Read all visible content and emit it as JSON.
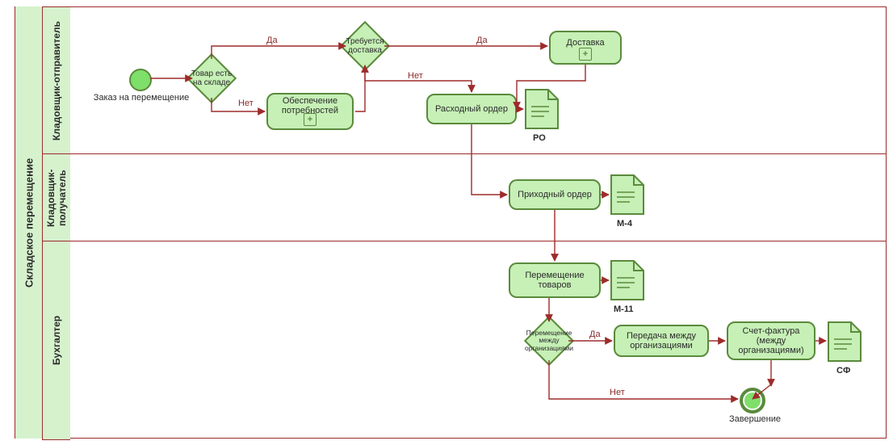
{
  "pool": {
    "title": "Складское перемещение"
  },
  "lanes": {
    "sender": {
      "title": "Кладовщик-отправитель"
    },
    "receiver": {
      "title": "Кладовщик-получатель"
    },
    "accountant": {
      "title": "Бухгалтер"
    }
  },
  "events": {
    "start": {
      "label": "Заказ на перемещение"
    },
    "end": {
      "label": "Завершение"
    }
  },
  "gateways": {
    "stock": {
      "label": "Товар есть на складе"
    },
    "delivery": {
      "label": "Требуется доставка"
    },
    "interorg": {
      "label": "Перемещение между организациями"
    }
  },
  "tasks": {
    "procurement": {
      "label": "Обеспечение потребностей"
    },
    "delivery": {
      "label": "Доставка"
    },
    "expense_order": {
      "label": "Расходный ордер"
    },
    "receipt_order": {
      "label": "Приходный ордер"
    },
    "goods_move": {
      "label": "Перемещение товаров"
    },
    "interorg_transfer": {
      "label": "Передача между организациями"
    },
    "invoice": {
      "label": "Счет-фактура (между организациями)"
    }
  },
  "documents": {
    "ro": {
      "label": "РО"
    },
    "m4": {
      "label": "М-4"
    },
    "m11": {
      "label": "М-11"
    },
    "sf": {
      "label": "СФ"
    }
  },
  "edgeLabels": {
    "yes1": "Да",
    "no1": "Нет",
    "yes2": "Да",
    "no2": "Нет",
    "yes3": "Да",
    "no3": "Нет"
  },
  "colors": {
    "lane": "#d6f2cd",
    "node": "#c6f0b6",
    "border": "#5a8a3c",
    "line": "#9e2b2b"
  }
}
